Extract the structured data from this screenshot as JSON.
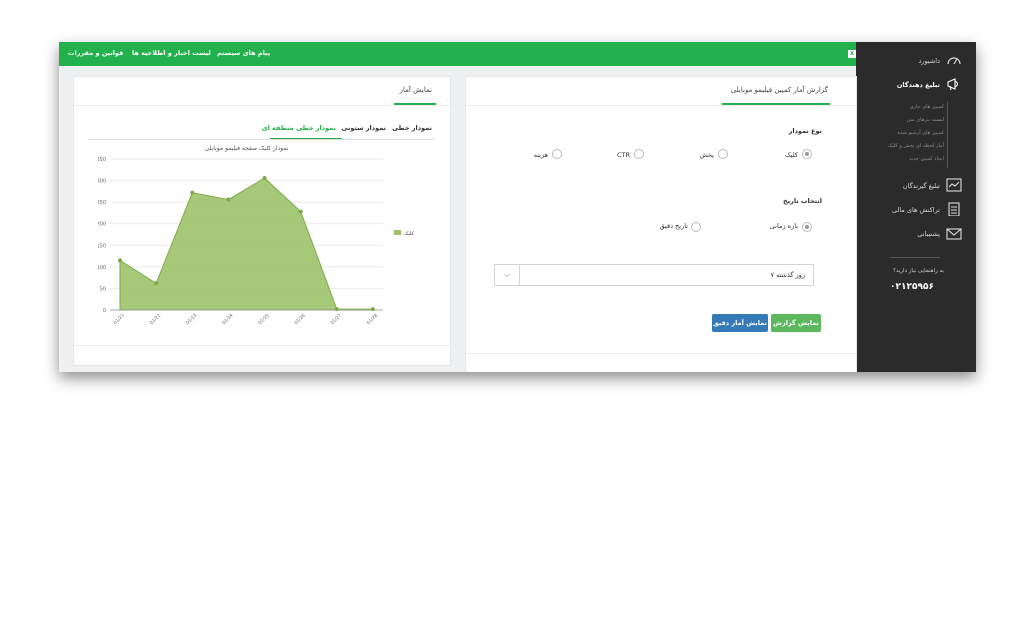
{
  "topbar": {
    "links": [
      "پیام های سیستم",
      "لیست اخبار و اطلاعیه ها",
      "قوانین و مقررات"
    ],
    "close_label": "x"
  },
  "sidebar": {
    "items": [
      {
        "label": "داشبورد",
        "icon": "speedometer-icon"
      },
      {
        "label": "تبلیغ دهندگان",
        "icon": "megaphone-icon"
      },
      {
        "label": "تبلیغ گیرندگان",
        "icon": "chart-monitor-icon"
      },
      {
        "label": "تراکنش های مالی",
        "icon": "clipboard-icon"
      },
      {
        "label": "پشتیبانی",
        "icon": "envelope-icon"
      }
    ],
    "subitems": [
      "کمپین های جاری",
      "لیست بنرهای متن",
      "کمپین های آرشیو شده",
      "آمار لحظه ای پخش و کلیک",
      "ایجاد کمپین جدید"
    ],
    "help_text": "به راهنمایی نیاز دارید؟",
    "phone": "۰۲۱۲۵۹۵۶"
  },
  "report_panel": {
    "title": "گزارش آمار کمپین فیلیمو موبایلی",
    "chart_type_label": "نوع نمودار",
    "chart_type_options": [
      "کلیک",
      "پخش",
      "CTR",
      "هزینه"
    ],
    "chart_type_selected": "کلیک",
    "date_label": "انتخاب تاریخ",
    "date_options": [
      "بازه زمانی",
      "تاریخ دقیق"
    ],
    "date_selected": "بازه زمانی",
    "range_value": "۷ روز گذشته",
    "show_report_button": "نمایش گزارش",
    "show_detail_button": "نمایش آمار دقیق"
  },
  "stats_panel": {
    "title": "نمایش آمار",
    "tabs": [
      "نمودار خطی",
      "نمودار ستونی",
      "نمودار خطی منطقه ای"
    ],
    "active_tab": "نمودار خطی منطقه ای"
  },
  "colors": {
    "accent": "#22b14c",
    "area_fill": "#9cc26a",
    "area_stroke": "#7faa48",
    "blue_button": "#337ab7",
    "green_button": "#5cb85c",
    "sidebar": "#2b2b2b"
  },
  "chart_data": {
    "type": "area",
    "title": "نمودار کلیک صفحه فیلیمو موبایلی",
    "ylabel": "کلیک",
    "ylim": [
      0,
      350
    ],
    "yticks": [
      0,
      50,
      100,
      150,
      200,
      250,
      300,
      350
    ],
    "x": [
      "01/21",
      "01/22",
      "01/23",
      "01/24",
      "01/25",
      "01/26",
      "01/27",
      "01/28"
    ],
    "series": [
      {
        "name": "کلیک",
        "values": [
          115,
          62,
          272,
          256,
          306,
          228,
          2,
          2
        ]
      }
    ],
    "legend_position": "right",
    "grid": true
  }
}
